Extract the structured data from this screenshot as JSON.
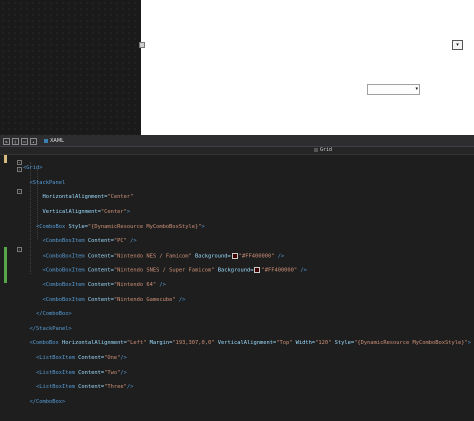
{
  "toolbar": {
    "xaml_tab": "XAML",
    "icons": [
      "swap-panes-icon",
      "vertical-split-icon",
      "horizontal-split-icon",
      "collapse-pane-icon"
    ]
  },
  "designer": {
    "small_combo_arrow": "▾",
    "wide_combo_arrow": "▾"
  },
  "breadcrumb": {
    "label": "Grid"
  },
  "colors": {
    "swatch_color": "#FF400000",
    "editor_bg": "#1e1e1e",
    "artboard": "#ffffff"
  },
  "code": {
    "l1": {
      "tag": "<Grid>"
    },
    "l2": {
      "tag": "<StackPanel"
    },
    "l3": {
      "attr": "HorizontalAlignment=",
      "val": "\"Center\""
    },
    "l4": {
      "attr": "VerticalAlignment=",
      "val": "\"Center\"",
      "end": ">"
    },
    "l5": {
      "tag": "<ComboBox",
      "attr": " Style=",
      "val": "\"{DynamicResource MyComboBoxStyle}\"",
      "end": ">"
    },
    "l6": {
      "tag": "<ComboBoxItem",
      "attr": " Content=",
      "val": "\"PC\"",
      "end": " />"
    },
    "l7": {
      "tag": "<ComboBoxItem",
      "attr": " Content=",
      "val": "\"Nintendo NES / Famicom\"",
      "attr2": " Background=",
      "val2": "\"#FF400000\"",
      "end": " />"
    },
    "l8": {
      "tag": "<ComboBoxItem",
      "attr": " Content=",
      "val": "\"Nintendo SNES / Super Famicom\"",
      "attr2": " Background=",
      "val2": "\"#FF400000\"",
      "end": " />"
    },
    "l9": {
      "tag": "<ComboBoxItem",
      "attr": " Content=",
      "val": "\"Nintendo 64\"",
      "end": " />"
    },
    "l10": {
      "tag": "<ComboBoxItem",
      "attr": " Content=",
      "val": "\"Nintendo Gamecube\"",
      "end": " />"
    },
    "l11": {
      "tag": "</ComboBox>"
    },
    "l12": {
      "tag": "</StackPanel>"
    },
    "l13": {
      "tag": "<ComboBox",
      "attr": " HorizontalAlignment=",
      "val": "\"Left\"",
      "attr2": " Margin=",
      "val2": "\"193,307,0,0\"",
      "attr3": " VerticalAlignment=",
      "val3": "\"Top\"",
      "attr4": " Width=",
      "val4": "\"120\"",
      "attr5": " Style=",
      "val5": "\"{DynamicResource MyComboBoxStyle}\"",
      "end": ">"
    },
    "l14": {
      "tag": "<ListBoxItem",
      "attr": " Content=",
      "val": "\"One\"",
      "end": "/>"
    },
    "l15": {
      "tag": "<ListBoxItem",
      "attr": " Content=",
      "val": "\"Two\"",
      "end": "/>"
    },
    "l16": {
      "tag": "<ListBoxItem",
      "attr": " Content=",
      "val": "\"Three\"",
      "end": "/>"
    },
    "l17": {
      "tag": "</ComboBox>"
    }
  }
}
